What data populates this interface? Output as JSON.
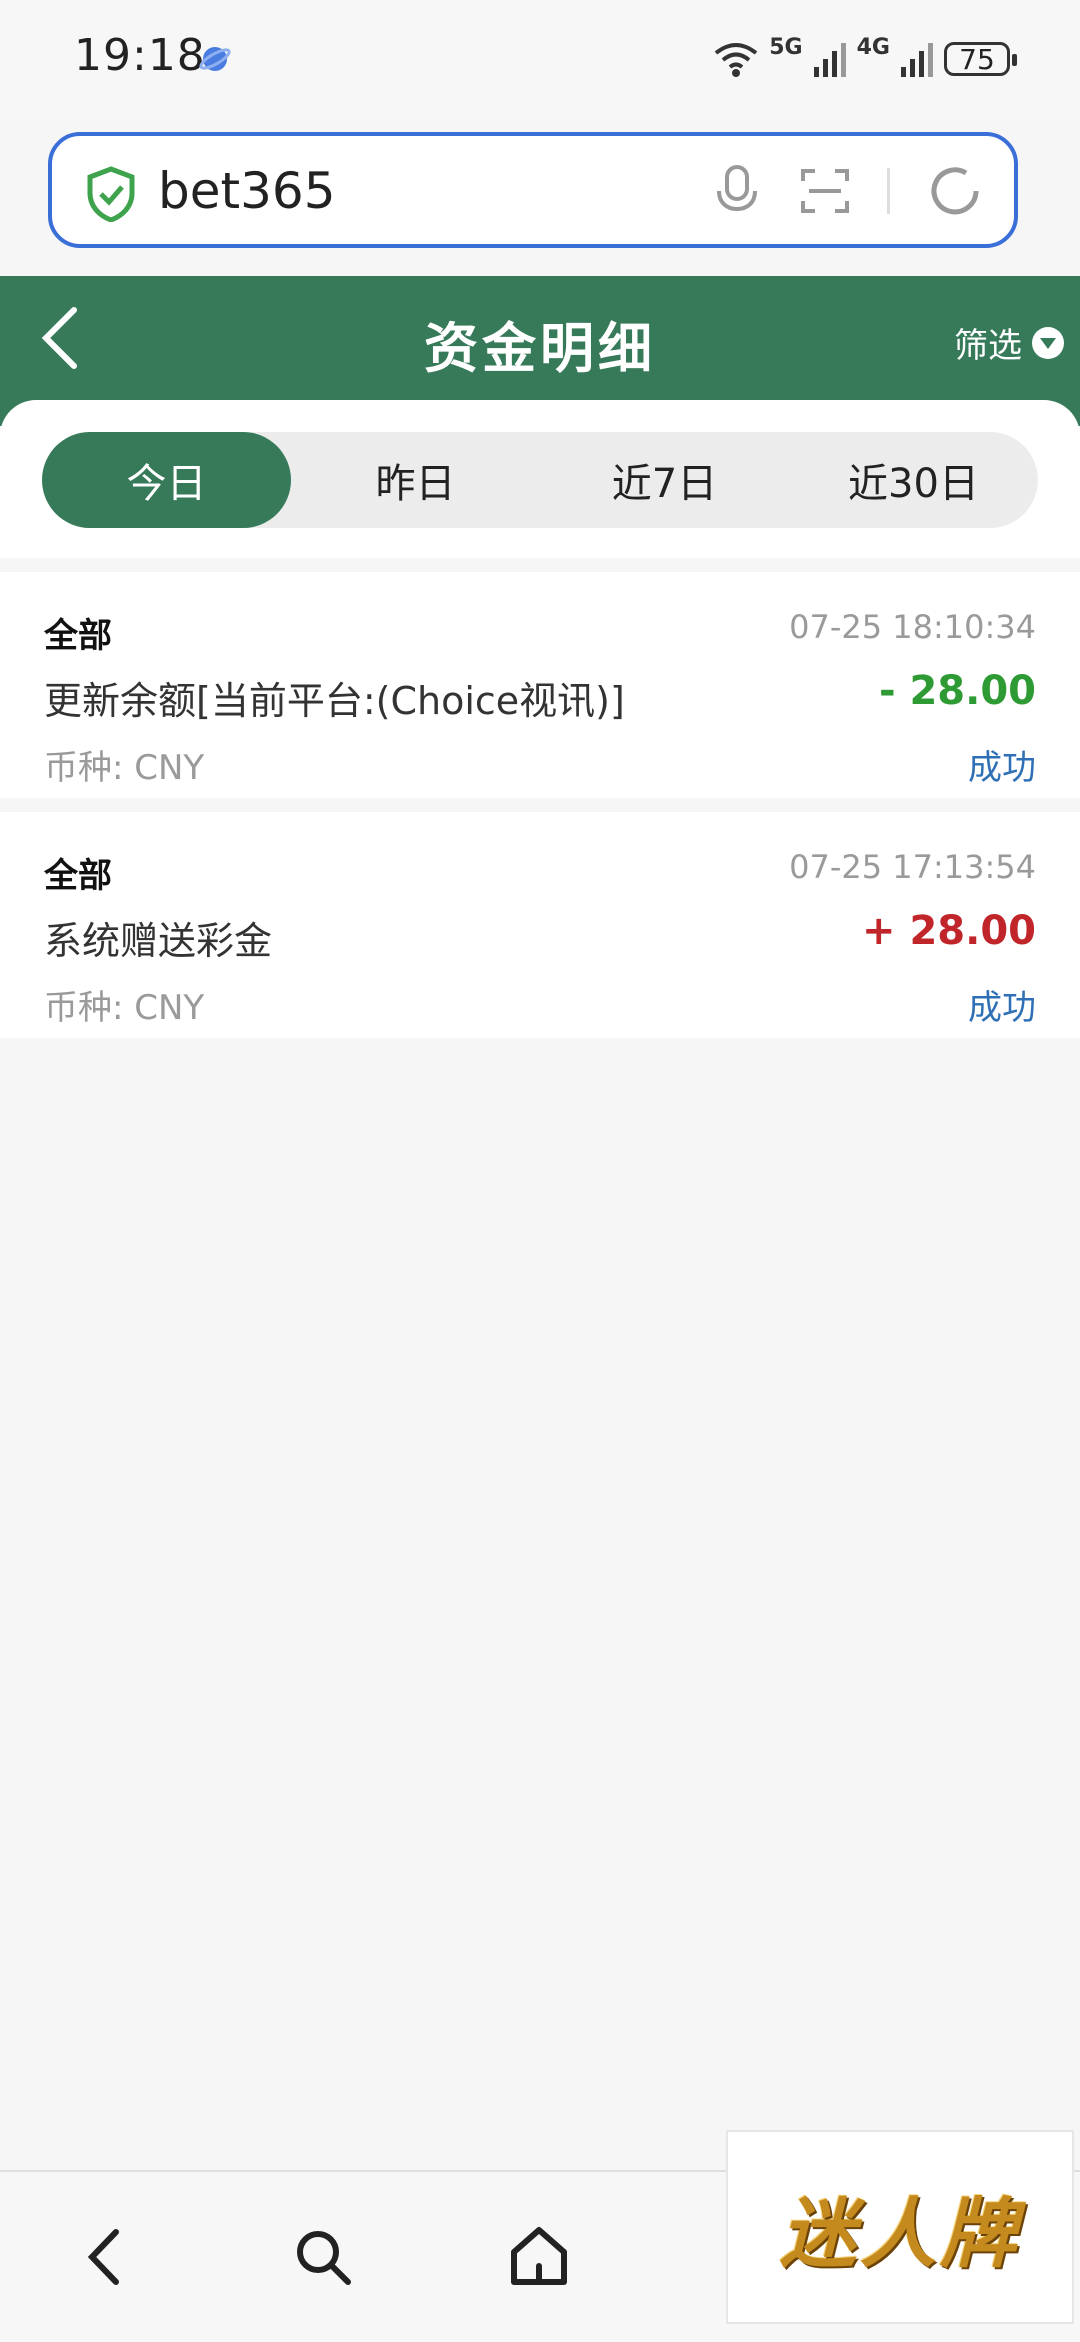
{
  "status_bar": {
    "time": "19:18",
    "net1": "5G",
    "net2": "4G",
    "battery": "75"
  },
  "browser": {
    "url": "bet365"
  },
  "header": {
    "title": "资金明细",
    "filter_label": "筛选"
  },
  "tabs": [
    {
      "label": "今日",
      "active": true
    },
    {
      "label": "昨日",
      "active": false
    },
    {
      "label": "近7日",
      "active": false
    },
    {
      "label": "近30日",
      "active": false
    }
  ],
  "records": [
    {
      "category": "全部",
      "time": "07-25 18:10:34",
      "description": "更新余额[当前平台:(Choice视讯)]",
      "amount": "- 28.00",
      "currency": "币种: CNY",
      "status": "成功"
    },
    {
      "category": "全部",
      "time": "07-25 17:13:54",
      "description": "系统赠送彩金",
      "amount": "+ 28.00",
      "currency": "币种: CNY",
      "status": "成功"
    }
  ],
  "ad": {
    "text": "迷人牌"
  },
  "colors": {
    "brand": "#367a5a",
    "url_border": "#3a6fd8",
    "minus": "#2e9a34",
    "plus": "#c0252a",
    "status": "#2f6fb5"
  }
}
